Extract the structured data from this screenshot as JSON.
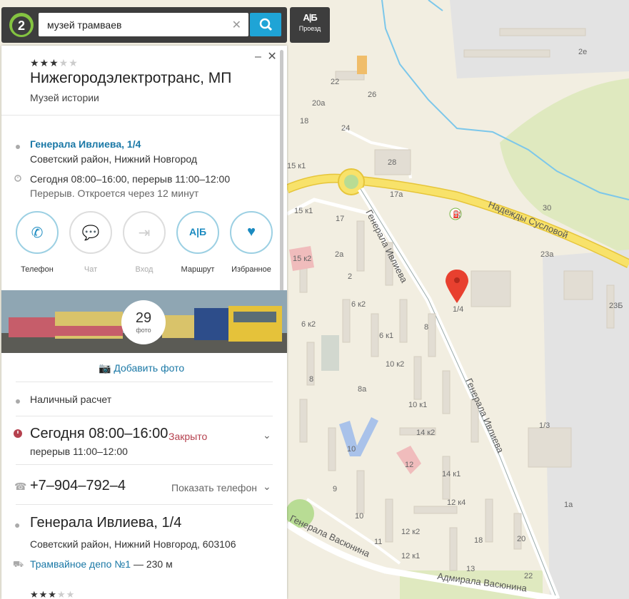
{
  "search": {
    "query": "музей трамваев"
  },
  "route_button": {
    "label": "Проезд",
    "icon": "route-ab-icon"
  },
  "firm": {
    "rating_stars": 3,
    "rating_max": 5,
    "name": "Нижегородэлектротранс, МП",
    "category": "Музей истории",
    "address_link": "Генерала Ивлиева, 1/4",
    "district": "Советский район, Нижний Новгород",
    "hours": "Сегодня 08:00–16:00, перерыв 11:00–12:00",
    "break_status": "Перерыв. Откроется через 12 минут"
  },
  "actions": [
    {
      "label": "Телефон",
      "icon": "phone-icon",
      "enabled": true
    },
    {
      "label": "Чат",
      "icon": "chat-icon",
      "enabled": false
    },
    {
      "label": "Вход",
      "icon": "entrance-icon",
      "enabled": false
    },
    {
      "label": "Маршрут",
      "icon": "route-ab-icon",
      "enabled": true
    },
    {
      "label": "Избранное",
      "icon": "heart-icon",
      "enabled": true
    }
  ],
  "photos": {
    "count": "29",
    "count_label": "фото",
    "add_label": "Добавить фото"
  },
  "details": {
    "payment": "Наличный расчет",
    "today_hours": "Сегодня 08:00–16:00",
    "closed_status": "Закрыто",
    "break_hours": "перерыв 11:00–12:00",
    "phone": "+7–904–792–4",
    "show_phone": "Показать телефон",
    "address_big": "Генерала Ивлиева, 1/4",
    "address_full": "Советский район, Нижний Новгород, 603106",
    "transit_link": "Трамвайное депо №1",
    "transit_distance": "— 230 м"
  },
  "map": {
    "streets": [
      "Надежды Сусловой",
      "Генерала Ивлиева",
      "Генерала Ивлиева",
      "Генерала Васюнина",
      "Адмирала Васюнина"
    ],
    "buildings": [
      "2е",
      "22",
      "20а",
      "26",
      "18",
      "24",
      "28",
      "15 к1",
      "17а",
      "30",
      "15 к1",
      "17",
      "23а",
      "15 к2",
      "2а",
      "2",
      "6 к2",
      "6 к2",
      "6 к1",
      "8",
      "23Б",
      "10 к2",
      "8",
      "8а",
      "10 к1",
      "14 к2",
      "1/3",
      "10",
      "12",
      "14 к1",
      "9",
      "12 к4",
      "1а",
      "10",
      "12 к2",
      "11",
      "18",
      "20",
      "12 к1",
      "13",
      "22"
    ],
    "marker_label": "1/4"
  },
  "colors": {
    "accent": "#1a78a6",
    "brand": "#84c341",
    "closed": "#b5414e"
  }
}
